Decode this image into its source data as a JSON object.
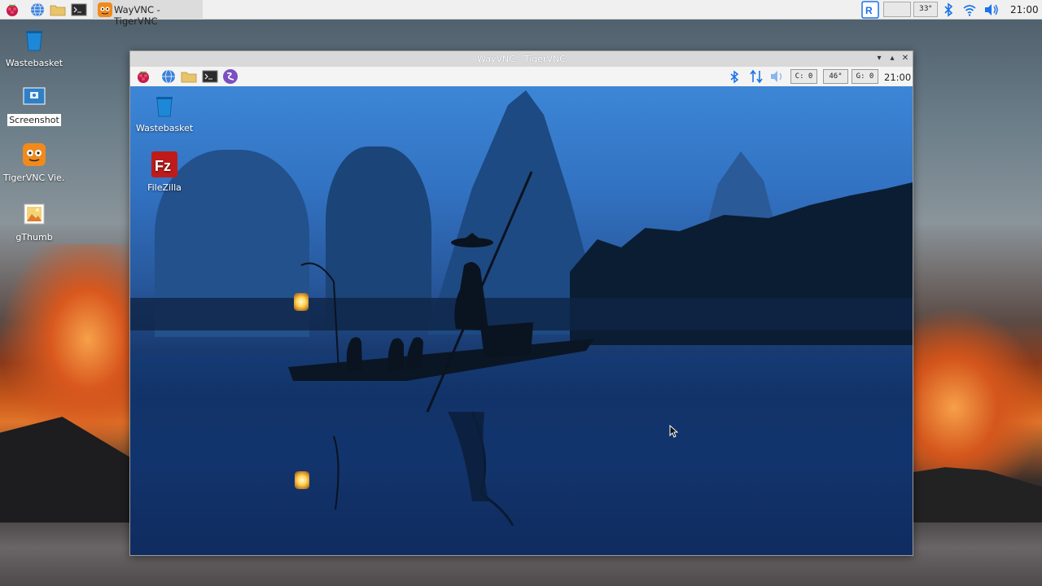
{
  "taskbar": {
    "launcher_icons": [
      "raspberry-menu-icon",
      "web-browser-icon",
      "file-manager-icon",
      "terminal-icon"
    ],
    "task": {
      "label": "WayVNC - TigerVNC"
    },
    "tray": {
      "temp": "33°",
      "clock": "21:00"
    }
  },
  "desktop_icons": [
    {
      "label": "Wastebasket"
    },
    {
      "label": "Screenshot"
    },
    {
      "label": "TigerVNC Vie…"
    },
    {
      "label": "gThumb"
    }
  ],
  "vnc_window": {
    "title": "WayVNC - TigerVNC",
    "inner_bar": {
      "cpu": "C:  0",
      "temp": "46°",
      "gpu": "G:  0",
      "clock": "21:00"
    },
    "desktop_icons": [
      {
        "label": "Wastebasket"
      },
      {
        "label": "FileZilla"
      }
    ]
  },
  "colors": {
    "accent": "#1a73e8",
    "taskbar_bg": "#f0f0f0"
  }
}
